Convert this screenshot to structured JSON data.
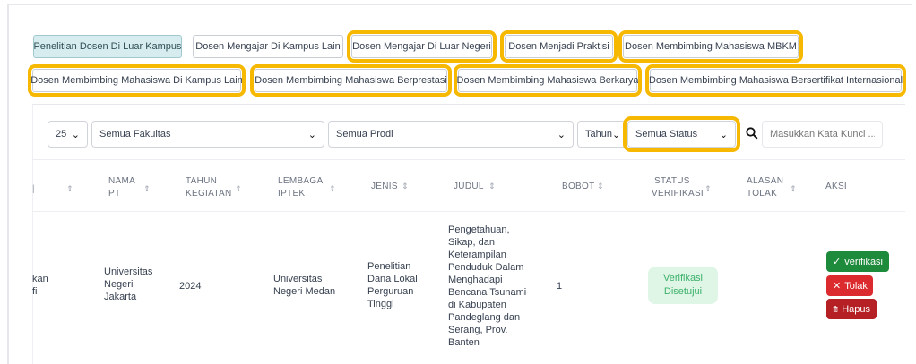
{
  "tabs": [
    {
      "label": "Penelitian Dosen Di Luar Kampus"
    },
    {
      "label": "Dosen Mengajar Di Kampus Lain"
    },
    {
      "label": "Dosen Mengajar Di Luar Negeri"
    },
    {
      "label": "Dosen Menjadi Praktisi"
    },
    {
      "label": "Dosen Membimbing Mahasiswa MBKM"
    },
    {
      "label": "Dosen Membimbing Mahasiswa Di Kampus Lain"
    },
    {
      "label": "Dosen Membimbing Mahasiswa Berprestasi"
    },
    {
      "label": "Dosen Membimbing Mahasiswa Berkarya"
    },
    {
      "label": "Dosen Membimbing Mahasiswa Bersertifikat Internasional"
    }
  ],
  "filters": {
    "per_page": "25",
    "fakultas": "Semua Fakultas",
    "prodi": "Semua Prodi",
    "tahun": "Tahun",
    "status": "Semua Status",
    "search_placeholder": "Masukkan Kata Kunci ..."
  },
  "columns": {
    "nama_pt": [
      "NAMA",
      "PT"
    ],
    "tahun_kegiatan": [
      "TAHUN",
      "KEGIATAN"
    ],
    "lembaga_iptek": [
      "LEMBAGA",
      "IPTEK"
    ],
    "jenis": "JENIS",
    "judul": "JUDUL",
    "bobot": "BOBOT",
    "status_verifikasi": [
      "STATUS",
      "VERIFIKASI"
    ],
    "alasan_tolak": [
      "ALASAN",
      "TOLAK"
    ],
    "aksi": "AKSI"
  },
  "row": {
    "cut_text": [
      "kan",
      "fi"
    ],
    "nama_pt": [
      "Universitas",
      "Negeri",
      "Jakarta"
    ],
    "tahun": "2024",
    "lembaga": [
      "Universitas",
      "Negeri Medan"
    ],
    "jenis": [
      "Penelitian",
      "Dana Lokal",
      "Perguruan",
      "Tinggi"
    ],
    "judul": [
      "Pengetahuan,",
      "Sikap, dan",
      "Keterampilan",
      "Penduduk Dalam",
      "Menghadapi",
      "Bencana Tsunami",
      "di Kabupaten",
      "Pandeglang dan",
      "Serang, Prov.",
      "Banten"
    ],
    "bobot": "1",
    "status": [
      "Verifikasi",
      "Disetujui"
    ]
  },
  "actions": {
    "verify": "verifikasi",
    "reject": "Tolak",
    "delete": "Hapus"
  },
  "colors": {
    "highlight": "#f6b800",
    "active_tab": "#d6ecef",
    "verify": "#1e8a3c",
    "reject": "#dc2b2f",
    "delete": "#b42024"
  }
}
